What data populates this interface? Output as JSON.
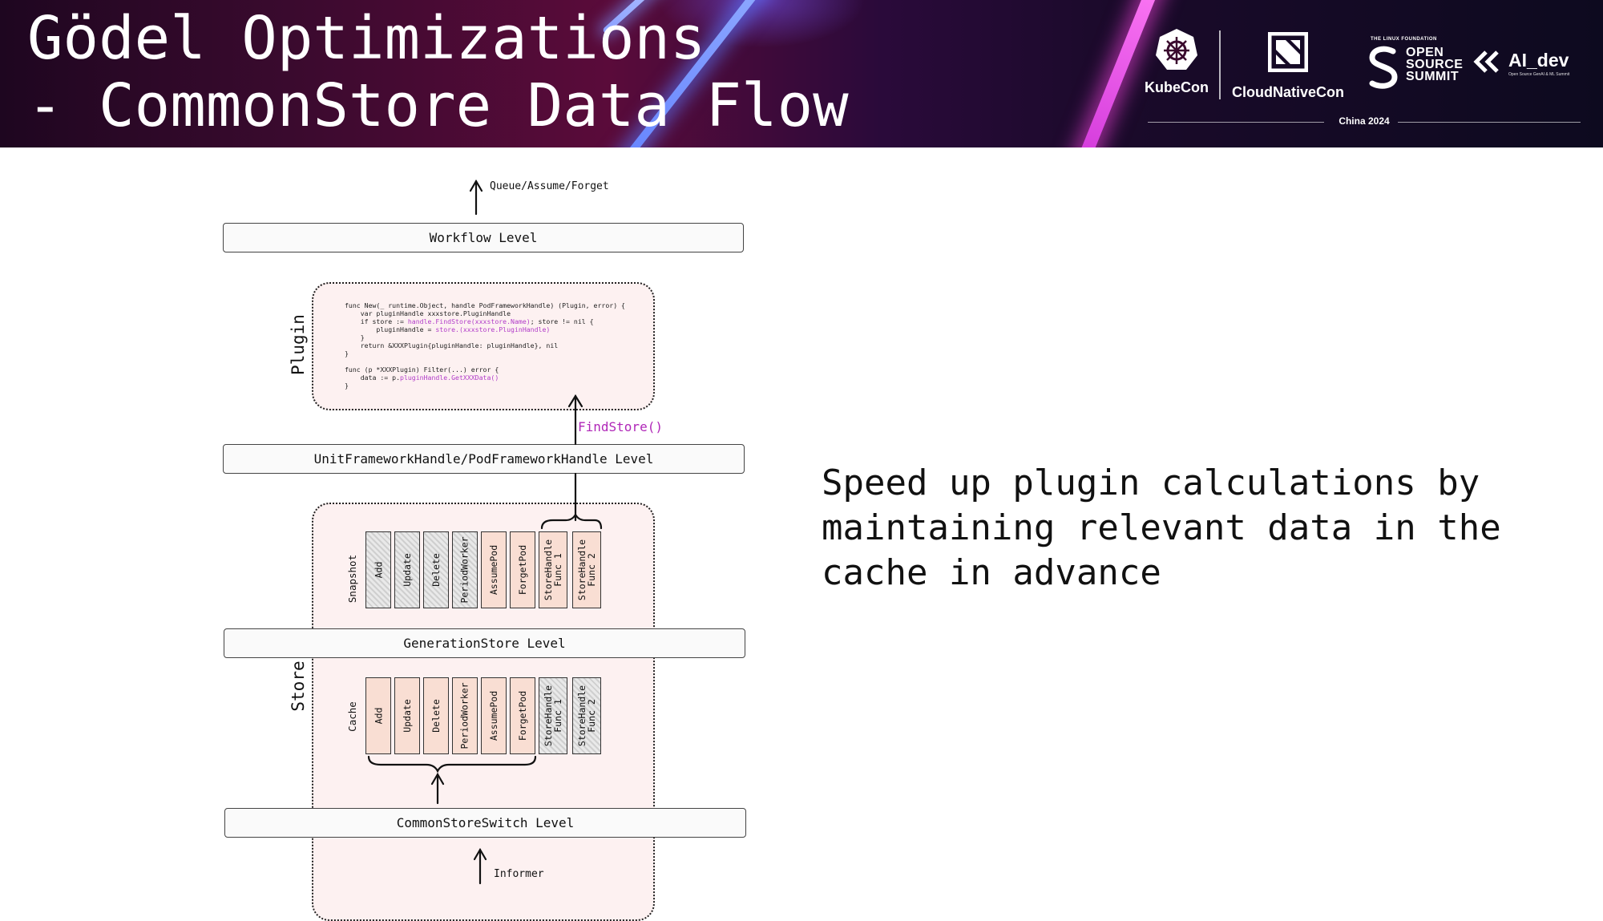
{
  "slide": {
    "title": "Gödel Optimizations\n- CommonStore Data Flow",
    "description": "Speed up plugin calculations by maintaining relevant data in the cache in advance"
  },
  "banner": {
    "logos": {
      "kubecon": "KubeCon",
      "cloudnativecon": "CloudNativeCon",
      "linux_foundation": "THE LINUX FOUNDATION",
      "open_source_summit": [
        "OPEN",
        "SOURCE",
        "SUMMIT"
      ],
      "ai_dev": "AI_dev",
      "ai_dev_sub": "Open Source GenAI & ML Summit",
      "event": "China 2024"
    },
    "icons": [
      "helm-wheel-icon",
      "cncf-icon",
      "oss-s-icon",
      "ai-dev-chevron-icon"
    ]
  },
  "diagram": {
    "top_arrow_label": "Queue/Assume/Forget",
    "bottom_arrow_label": "Informer",
    "levels": {
      "workflow": "Workflow Level",
      "framework_handle": "UnitFrameworkHandle/PodFrameworkHandle Level",
      "generation_store": "GenerationStore Level",
      "common_store_switch": "CommonStoreSwitch Level"
    },
    "plugin_label": "Plugin",
    "store_label": "Store",
    "find_store_label": "FindStore()",
    "plugin_code": {
      "l1": "func New(_ runtime.Object, handle PodFrameworkHandle) (Plugin, error) {",
      "l2": "    var pluginHandle xxxstore.PluginHandle",
      "l3a": "    if store := ",
      "l3b": "handle.FindStore(xxxstore.Name)",
      "l3c": "; store != nil {",
      "l4a": "        pluginHandle = ",
      "l4b": "store.(xxxstore.PluginHandle)",
      "l5": "    }",
      "l6": "    return &XXXPlugin{pluginHandle: pluginHandle}, nil",
      "l7": "}",
      "l8": "func (p *XXXPlugin) Filter(...) error {",
      "l9a": "    data := p.",
      "l9b": "pluginHandle.GetXXXData()",
      "l10": "}"
    },
    "snapshot": {
      "label": "Snapshot",
      "cells": [
        "Add",
        "Update",
        "Delete",
        "PeriodWorker",
        "AssumePod",
        "ForgetPod",
        "StoreHandle\nFunc 1",
        "StoreHandle\nFunc 2"
      ]
    },
    "cache": {
      "label": "Cache",
      "cells": [
        "Add",
        "Update",
        "Delete",
        "PeriodWorker",
        "AssumePod",
        "ForgetPod",
        "StoreHandle\nFunc 1",
        "StoreHandle\nFunc 2"
      ]
    },
    "colors": {
      "plugin_purple": "#b027b8",
      "box_fill": "#fdf1f1",
      "cell_peach": "#f9ded3"
    }
  }
}
